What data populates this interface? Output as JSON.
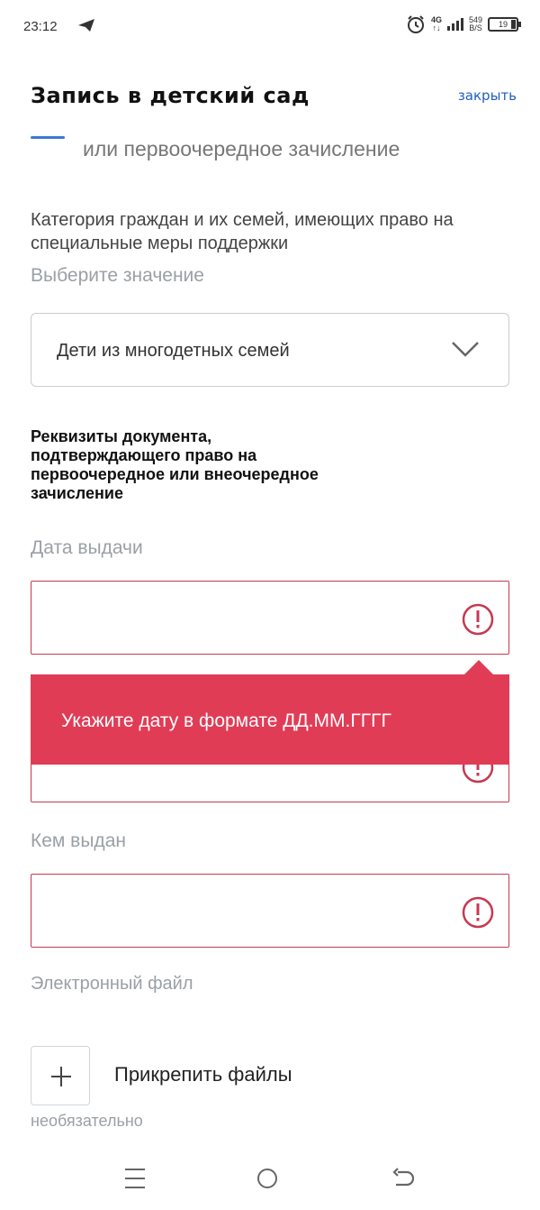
{
  "status_bar": {
    "time": "23:12",
    "network": "4G",
    "speed_value": "549",
    "speed_unit": "B/S",
    "battery": "19"
  },
  "header": {
    "title": "Запись в детский сад",
    "close_label": "закрыть"
  },
  "form": {
    "partial_option_text": "или первоочередное зачисление",
    "category": {
      "label": "Категория граждан и их семей, имеющих право на специальные меры поддержки",
      "hint": "Выберите значение",
      "selected_value": "Дети из многодетных семей"
    },
    "section_title": "Реквизиты документа, подтверждающего право на первоочередное или внеочередное зачисление",
    "issue_date": {
      "label": "Дата выдачи",
      "value": "",
      "error": "Укажите дату в формате ДД.ММ.ГГГГ"
    },
    "issued_by": {
      "label": "Кем выдан",
      "value": ""
    },
    "file": {
      "label": "Электронный файл",
      "attach_label": "Прикрепить файлы",
      "optional_note": "необязательно"
    }
  },
  "colors": {
    "error": "#c53a52",
    "tooltip": "#e13c56",
    "link": "#1f5fbf",
    "accent": "#3b78d8"
  },
  "icons": [
    "telegram-send-icon",
    "alarm-icon",
    "signal-icon",
    "battery-icon",
    "chevron-down-icon",
    "error-icon",
    "plus-icon",
    "menu-icon",
    "home-icon",
    "back-icon"
  ]
}
